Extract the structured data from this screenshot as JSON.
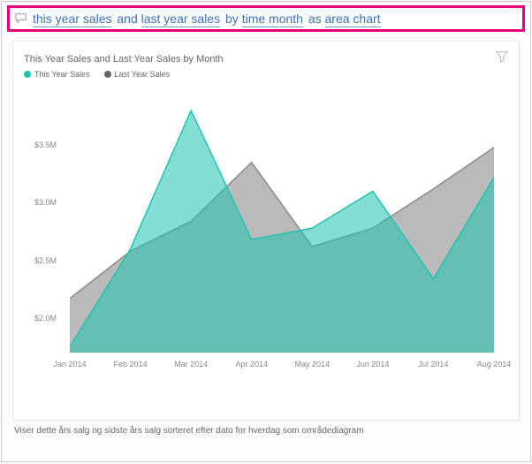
{
  "query": {
    "segments": [
      {
        "text": "this year sales",
        "underlined": true
      },
      {
        "text": "and",
        "underlined": false
      },
      {
        "text": "last year sales",
        "underlined": true
      },
      {
        "text": "by",
        "underlined": false
      },
      {
        "text": "time month",
        "underlined": true
      },
      {
        "text": "as",
        "underlined": false
      },
      {
        "text": "area chart",
        "underlined": true
      }
    ]
  },
  "chart": {
    "title": "This Year Sales and Last Year Sales by Month",
    "legend": [
      {
        "name": "This Year Sales",
        "color": "#1fc3b0"
      },
      {
        "name": "Last Year Sales",
        "color": "#666666"
      }
    ]
  },
  "footer": "Viser dette års salg og sidste års salg sorteret efter dato for hverdag som områdediagram",
  "chart_data": {
    "type": "area",
    "title": "This Year Sales and Last Year Sales by Month",
    "xlabel": "",
    "ylabel": "",
    "ylim": [
      1700000,
      4000000
    ],
    "y_ticks": [
      "$2.0M",
      "$2.5M",
      "$3.0M",
      "$3.5M"
    ],
    "categories": [
      "Jan 2014",
      "Feb 2014",
      "Mar 2014",
      "Apr 2014",
      "May 2014",
      "Jun 2014",
      "Jul 2014",
      "Aug 2014"
    ],
    "series": [
      {
        "name": "This Year Sales",
        "color": "#1fc3b0",
        "values": [
          1750000,
          2600000,
          3800000,
          2680000,
          2780000,
          3100000,
          2340000,
          3220000
        ]
      },
      {
        "name": "Last Year Sales",
        "color": "#8a8a8a",
        "values": [
          2170000,
          2580000,
          2840000,
          3350000,
          2620000,
          2780000,
          3120000,
          3480000
        ]
      }
    ]
  }
}
